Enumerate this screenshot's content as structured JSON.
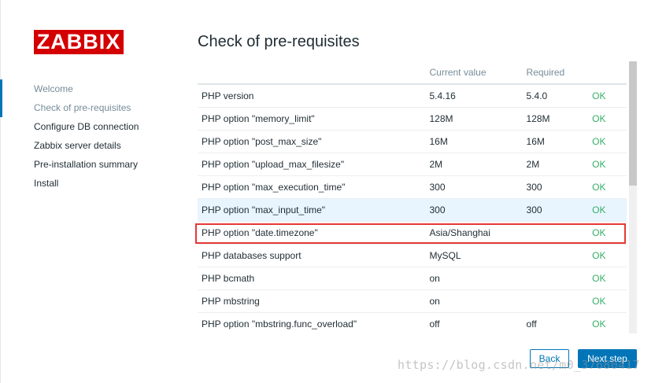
{
  "logo": {
    "text": "ZABBIX"
  },
  "nav": {
    "items": [
      {
        "label": "Welcome"
      },
      {
        "label": "Check of pre-requisites"
      },
      {
        "label": "Configure DB connection"
      },
      {
        "label": "Zabbix server details"
      },
      {
        "label": "Pre-installation summary"
      },
      {
        "label": "Install"
      }
    ]
  },
  "main": {
    "title": "Check of pre-requisites",
    "columns": [
      "",
      "Current value",
      "Required",
      ""
    ],
    "rows": [
      {
        "name": "PHP version",
        "current": "5.4.16",
        "required": "5.4.0",
        "status": "OK"
      },
      {
        "name": "PHP option \"memory_limit\"",
        "current": "128M",
        "required": "128M",
        "status": "OK"
      },
      {
        "name": "PHP option \"post_max_size\"",
        "current": "16M",
        "required": "16M",
        "status": "OK"
      },
      {
        "name": "PHP option \"upload_max_filesize\"",
        "current": "2M",
        "required": "2M",
        "status": "OK"
      },
      {
        "name": "PHP option \"max_execution_time\"",
        "current": "300",
        "required": "300",
        "status": "OK"
      },
      {
        "name": "PHP option \"max_input_time\"",
        "current": "300",
        "required": "300",
        "status": "OK"
      },
      {
        "name": "PHP option \"date.timezone\"",
        "current": "Asia/Shanghai",
        "required": "",
        "status": "OK"
      },
      {
        "name": "PHP databases support",
        "current": "MySQL",
        "required": "",
        "status": "OK"
      },
      {
        "name": "PHP bcmath",
        "current": "on",
        "required": "",
        "status": "OK"
      },
      {
        "name": "PHP mbstring",
        "current": "on",
        "required": "",
        "status": "OK"
      },
      {
        "name": "PHP option \"mbstring.func_overload\"",
        "current": "off",
        "required": "off",
        "status": "OK"
      }
    ]
  },
  "buttons": {
    "back": "Back",
    "next": "Next step"
  },
  "watermark": "https://blog.csdn.net/m0_37680417",
  "colors": {
    "brand": "#d40000",
    "ok": "#34af67",
    "accent": "#0275b8",
    "highlight_box": "#e53935"
  }
}
